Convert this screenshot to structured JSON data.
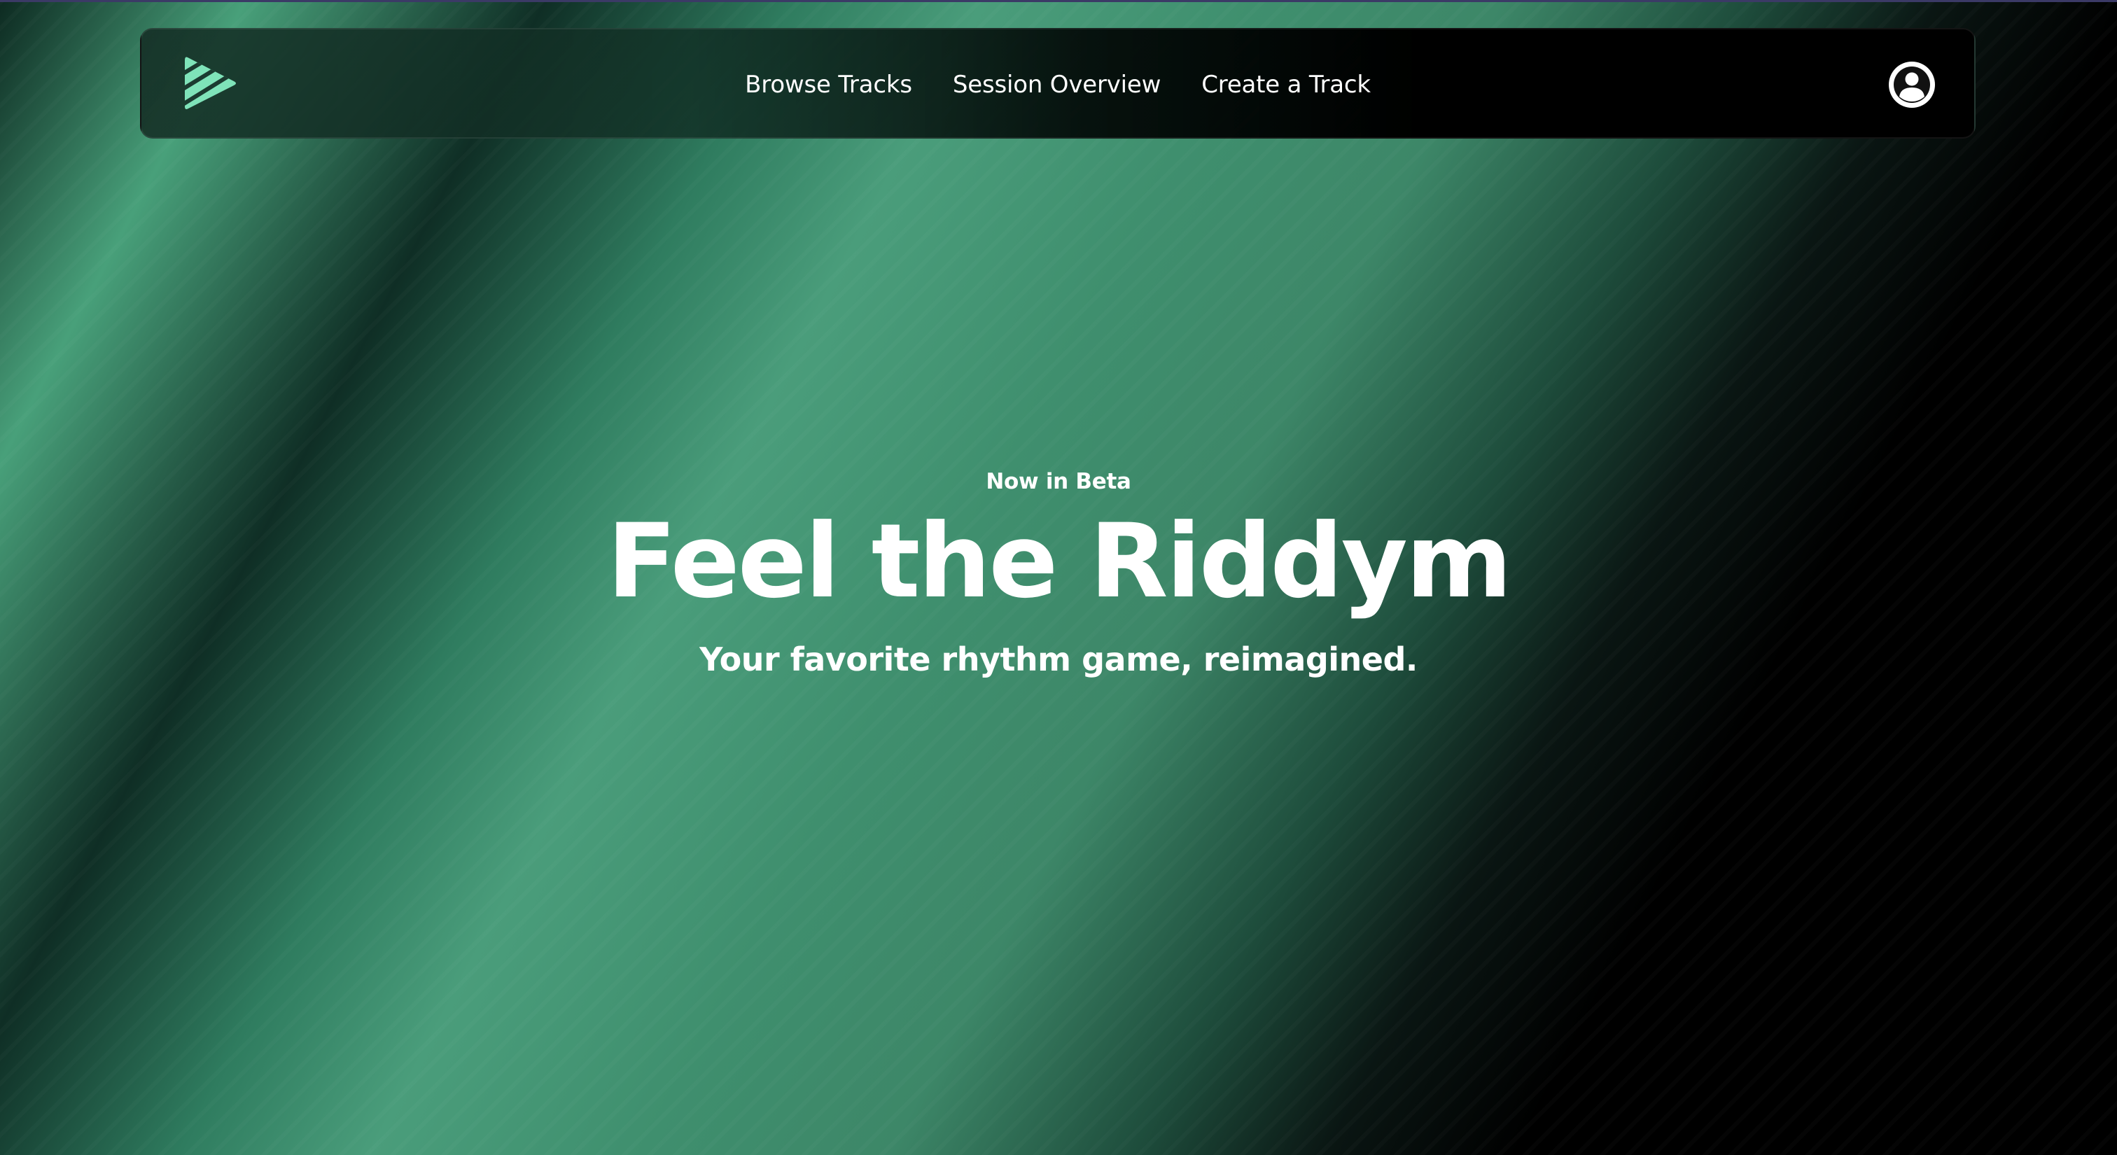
{
  "nav": {
    "logo_icon": "play-triangle-logo-icon",
    "links": [
      {
        "label": "Browse Tracks"
      },
      {
        "label": "Session Overview"
      },
      {
        "label": "Create a Track"
      }
    ],
    "account_icon": "user-account-icon"
  },
  "hero": {
    "eyebrow": "Now in Beta",
    "headline": "Feel the Riddym",
    "subheadline": "Your favorite rhythm game, reimagined."
  },
  "colors": {
    "accent": "#7fe3b9",
    "green_band": "#48a07a",
    "background": "#000000",
    "text": "#ffffff"
  }
}
